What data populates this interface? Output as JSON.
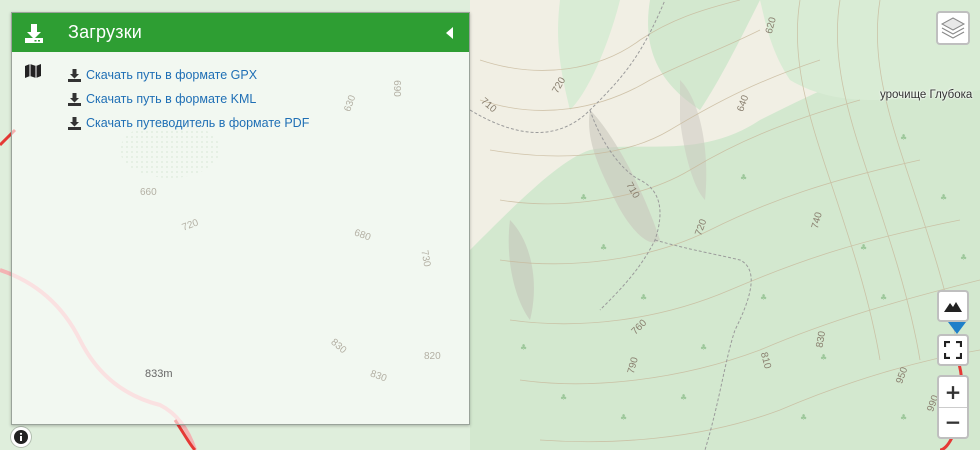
{
  "panel": {
    "title": "Загрузки",
    "links": [
      {
        "label": "Скачать путь в формате GPX"
      },
      {
        "label": "Скачать путь в формате KML"
      },
      {
        "label": "Скачать путеводитель в формате PDF"
      }
    ]
  },
  "map": {
    "place_label": "урочище Глубока",
    "peak_label": "833m",
    "contour_labels": [
      "710",
      "720",
      "630",
      "690",
      "660",
      "720",
      "680",
      "730",
      "820",
      "830",
      "830",
      "710",
      "720",
      "640",
      "620",
      "740",
      "760",
      "790",
      "810",
      "830",
      "950",
      "990"
    ]
  },
  "colors": {
    "header": "#2e9e33",
    "link": "#1f6fb5",
    "forest": "#cfe6cc",
    "track": "#e53935"
  },
  "icons": {
    "header": "download-icon",
    "collapse": "caret-left-icon",
    "map": "map-icon",
    "layers": "layers-icon",
    "terrain": "mountain-icon",
    "fullscreen": "fullscreen-icon",
    "info": "info-icon"
  },
  "controls": {
    "zoom_in": "+",
    "zoom_out": "−"
  }
}
